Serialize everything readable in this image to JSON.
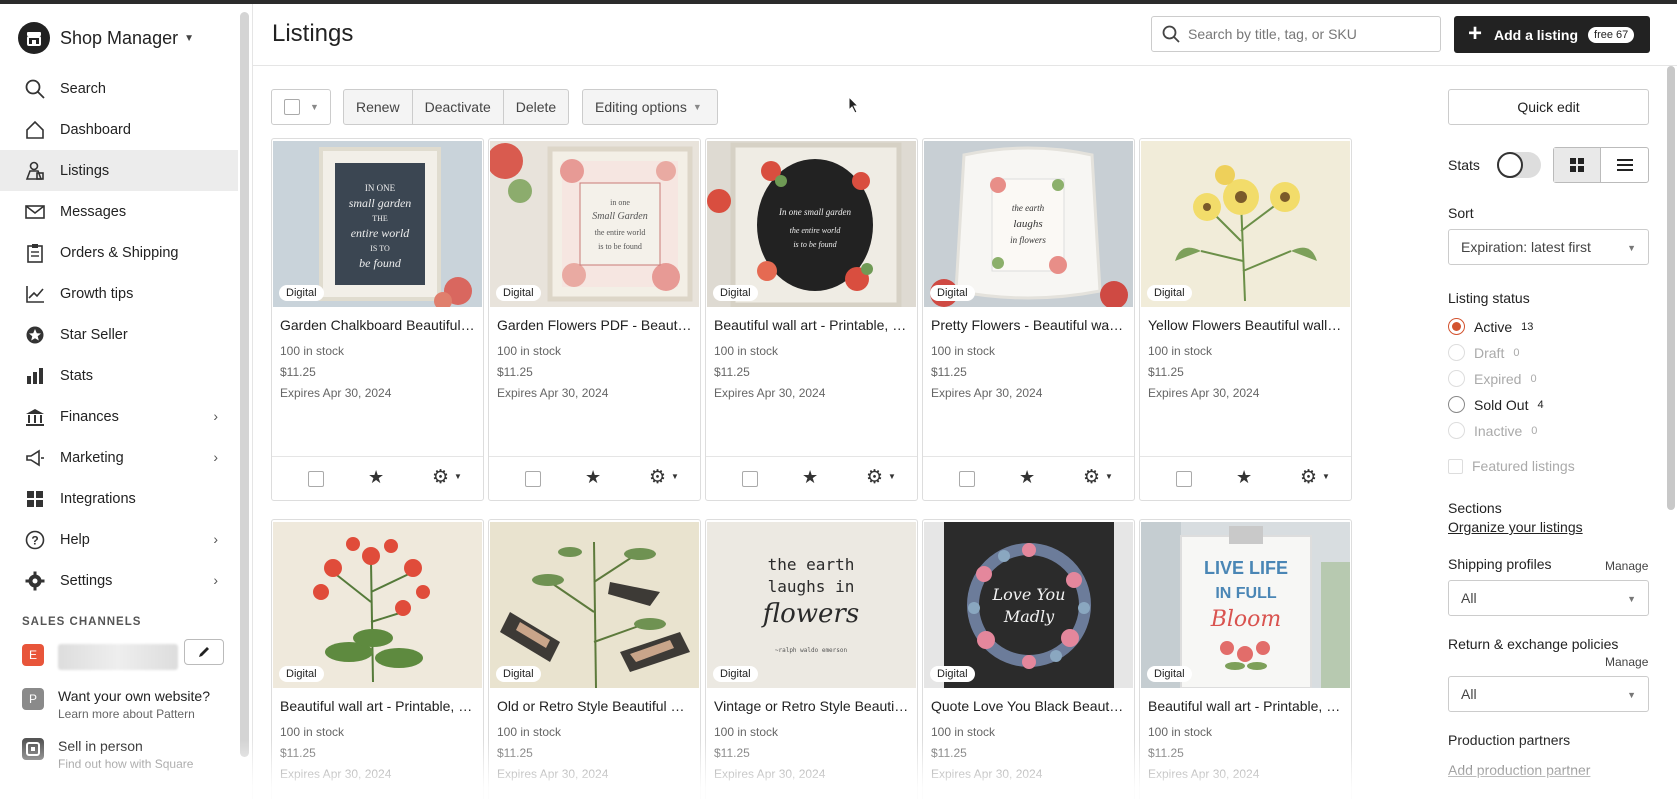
{
  "app": {
    "name": "Shop Manager"
  },
  "sidebar": {
    "items": [
      {
        "label": "Search",
        "icon": "search-icon"
      },
      {
        "label": "Dashboard",
        "icon": "home-icon"
      },
      {
        "label": "Listings",
        "icon": "listings-icon",
        "active": true
      },
      {
        "label": "Messages",
        "icon": "envelope-icon"
      },
      {
        "label": "Orders & Shipping",
        "icon": "clipboard-icon"
      },
      {
        "label": "Growth tips",
        "icon": "growth-icon"
      },
      {
        "label": "Star Seller",
        "icon": "star-seller-icon"
      },
      {
        "label": "Stats",
        "icon": "bar-chart-icon"
      },
      {
        "label": "Finances",
        "icon": "bank-icon",
        "chevron": true
      },
      {
        "label": "Marketing",
        "icon": "megaphone-icon",
        "chevron": true
      },
      {
        "label": "Integrations",
        "icon": "grid-icon"
      },
      {
        "label": "Help",
        "icon": "help-icon",
        "chevron": true
      },
      {
        "label": "Settings",
        "icon": "gear-icon",
        "chevron": true
      }
    ],
    "sales_channels_header": "SALES CHANNELS",
    "channels": [
      {
        "badge": "E",
        "badge_color": "#e8553a"
      },
      {
        "badge": "P",
        "badge_color": "#8a8a8a",
        "title": "Want your own website?",
        "subtitle": "Learn more about Pattern"
      },
      {
        "badge": "sq",
        "badge_color": "#555555",
        "title": "Sell in person",
        "subtitle": "Find out how with Square"
      }
    ]
  },
  "header": {
    "title": "Listings",
    "search_placeholder": "Search by title, tag, or SKU",
    "add_button_label": "Add a listing",
    "free_badge": "free 67"
  },
  "toolbar": {
    "renew": "Renew",
    "deactivate": "Deactivate",
    "delete": "Delete",
    "editing_options": "Editing options"
  },
  "listings": [
    {
      "title": "Garden Chalkboard Beautiful wall art",
      "stock": "100 in stock",
      "price": "$11.25",
      "expires": "Expires Apr 30, 2024",
      "badge": "Digital"
    },
    {
      "title": "Garden Flowers PDF - Beautiful wall art",
      "stock": "100 in stock",
      "price": "$11.25",
      "expires": "Expires Apr 30, 2024",
      "badge": "Digital"
    },
    {
      "title": "Beautiful wall art - Printable, Garden",
      "stock": "100 in stock",
      "price": "$11.25",
      "expires": "Expires Apr 30, 2024",
      "badge": "Digital"
    },
    {
      "title": "Pretty Flowers - Beautiful wall art",
      "stock": "100 in stock",
      "price": "$11.25",
      "expires": "Expires Apr 30, 2024",
      "badge": "Digital"
    },
    {
      "title": "Yellow Flowers Beautiful wall art",
      "stock": "100 in stock",
      "price": "$11.25",
      "expires": "Expires Apr 30, 2024",
      "badge": "Digital"
    },
    {
      "title": "Beautiful wall art - Printable, Flowers",
      "stock": "100 in stock",
      "price": "$11.25",
      "expires": "Expires Apr 30, 2024",
      "badge": "Digital"
    },
    {
      "title": "Old or Retro Style Beautiful wall art",
      "stock": "100 in stock",
      "price": "$11.25",
      "expires": "Expires Apr 30, 2024",
      "badge": "Digital"
    },
    {
      "title": "Vintage or Retro Style Beautiful wall art",
      "stock": "100 in stock",
      "price": "$11.25",
      "expires": "Expires Apr 30, 2024",
      "badge": "Digital"
    },
    {
      "title": "Quote Love You Black Beautiful wall art",
      "stock": "100 in stock",
      "price": "$11.25",
      "expires": "Expires Apr 30, 2024",
      "badge": "Digital"
    },
    {
      "title": "Beautiful wall art - Printable, Live Life",
      "stock": "100 in stock",
      "price": "$11.25",
      "expires": "Expires Apr 30, 2024",
      "badge": "Digital"
    }
  ],
  "right_panel": {
    "quick_edit": "Quick edit",
    "stats_label": "Stats",
    "sort_label": "Sort",
    "sort_value": "Expiration: latest first",
    "status_label": "Listing status",
    "statuses": [
      {
        "label": "Active",
        "count": "13",
        "checked": true,
        "enabled": true
      },
      {
        "label": "Draft",
        "count": "0",
        "checked": false,
        "enabled": false
      },
      {
        "label": "Expired",
        "count": "0",
        "checked": false,
        "enabled": false
      },
      {
        "label": "Sold Out",
        "count": "4",
        "checked": false,
        "enabled": true
      },
      {
        "label": "Inactive",
        "count": "0",
        "checked": false,
        "enabled": false
      }
    ],
    "featured_listings": "Featured listings",
    "sections_label": "Sections",
    "organize_link": "Organize your listings",
    "shipping_label": "Shipping profiles",
    "shipping_manage": "Manage",
    "shipping_value": "All",
    "return_label": "Return & exchange policies",
    "return_manage": "Manage",
    "return_value": "All",
    "production_label": "Production partners",
    "production_link": "Add production partner"
  },
  "colors": {
    "accent": "#d3532f",
    "dark": "#222222"
  }
}
